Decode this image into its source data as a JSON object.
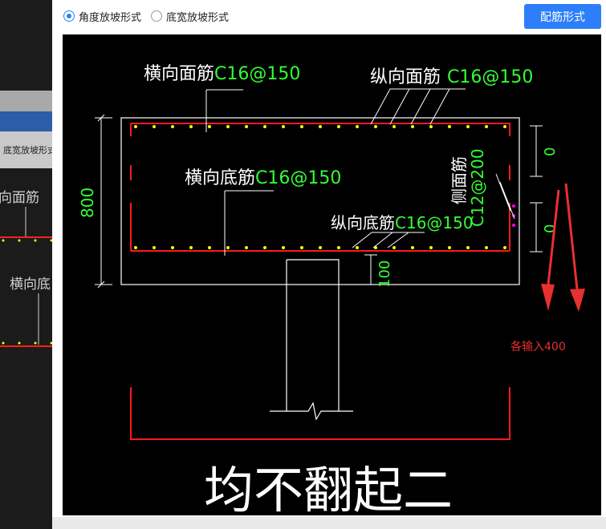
{
  "background": {
    "tab_label": "底宽放坡形式",
    "text_1": "向面筋",
    "text_2": "横向底"
  },
  "dialog": {
    "options": [
      {
        "label": "角度放坡形式",
        "checked": true
      },
      {
        "label": "底宽放坡形式",
        "checked": false
      }
    ],
    "button_label": "配筋形式"
  },
  "drawing": {
    "top_transverse": {
      "name": "横向面筋",
      "spec": "C16@150"
    },
    "top_longitudinal": {
      "name": "纵向面筋",
      "spec": "C16@150"
    },
    "bottom_transverse": {
      "name": "横向底筋",
      "spec": "C16@150"
    },
    "bottom_longitudinal": {
      "name": "纵向底筋",
      "spec": "C16@150"
    },
    "side": {
      "name": "侧面筋",
      "spec": "C12@200"
    },
    "dim_height": "800",
    "dim_cover": "100",
    "dim_right_top": "0",
    "dim_right_bottom": "0",
    "note": "各输入400",
    "caption": "均不翻起二"
  },
  "colors": {
    "accent": "#2d7ff9",
    "rebar": "#ff1a1a",
    "spec_text": "#33ff33",
    "dots": "#ffff00",
    "side_dots": "#ff00ff",
    "annotation": "#e83030"
  }
}
